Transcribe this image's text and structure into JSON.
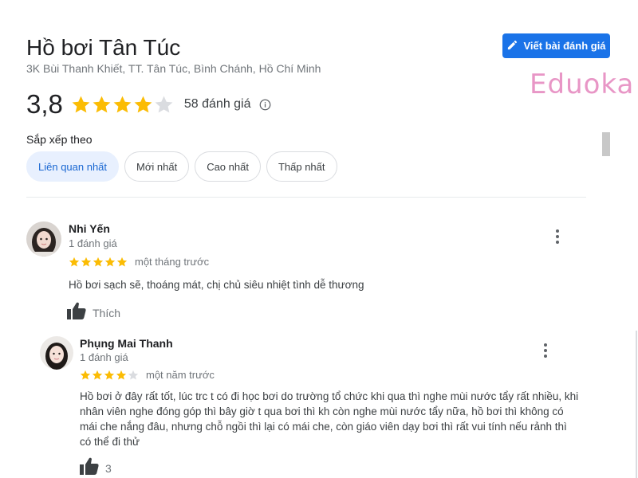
{
  "place": {
    "name": "Hồ bơi Tân Túc",
    "address": "3K Bùi Thanh Khiết, TT. Tân Túc, Bình Chánh, Hồ Chí Minh"
  },
  "write_review_label": "Viết bài đánh giá",
  "watermark": "Eduoka",
  "rating": {
    "value": "3,8",
    "stars": 4,
    "count_label": "58 đánh giá"
  },
  "sort": {
    "label": "Sắp xếp theo",
    "options": [
      "Liên quan nhất",
      "Mới nhất",
      "Cao nhất",
      "Thấp nhất"
    ],
    "selected": "Liên quan nhất"
  },
  "reviews": [
    {
      "name": "Nhi Yến",
      "count": "1 đánh giá",
      "stars": 5,
      "date": "một tháng trước",
      "text": "Hồ bơi sạch sẽ, thoáng mát, chị chủ siêu nhiệt tình dễ thương",
      "like_label": "Thích"
    },
    {
      "name": "Phụng Mai Thanh",
      "count": "1 đánh giá",
      "stars": 4,
      "date": "một năm trước",
      "text_lines": [
        "Hồ bơi ở đây rất tốt, lúc trc t có đi học bơi do trường tổ chức khi qua thì nghe mùi nước tẩy rất nhiều, khi",
        "nhân viên nghe đóng góp thì bây giờ t qua bơi thì kh còn nghe mùi nước tẩy nữa, hồ bơi thì không có",
        "mái che nắng đâu, nhưng chỗ ngồi thì lại có mái che, còn giáo viên dạy bơi thì rất vui tính nếu rảnh thì",
        "có thể đi thử"
      ],
      "like_label": "3"
    }
  ],
  "colors": {
    "accent": "#1a73e8",
    "star_filled": "#fbbc04",
    "star_empty": "#dadce0",
    "chip_active_bg": "#e8f0fe",
    "chip_active_text": "#1967d2",
    "watermark": "#e896c6"
  },
  "icons": {
    "write": "pencil-icon",
    "info": "info-icon",
    "more": "more-vert-icon",
    "like": "thumbs-up-icon",
    "star": "star-icon"
  }
}
